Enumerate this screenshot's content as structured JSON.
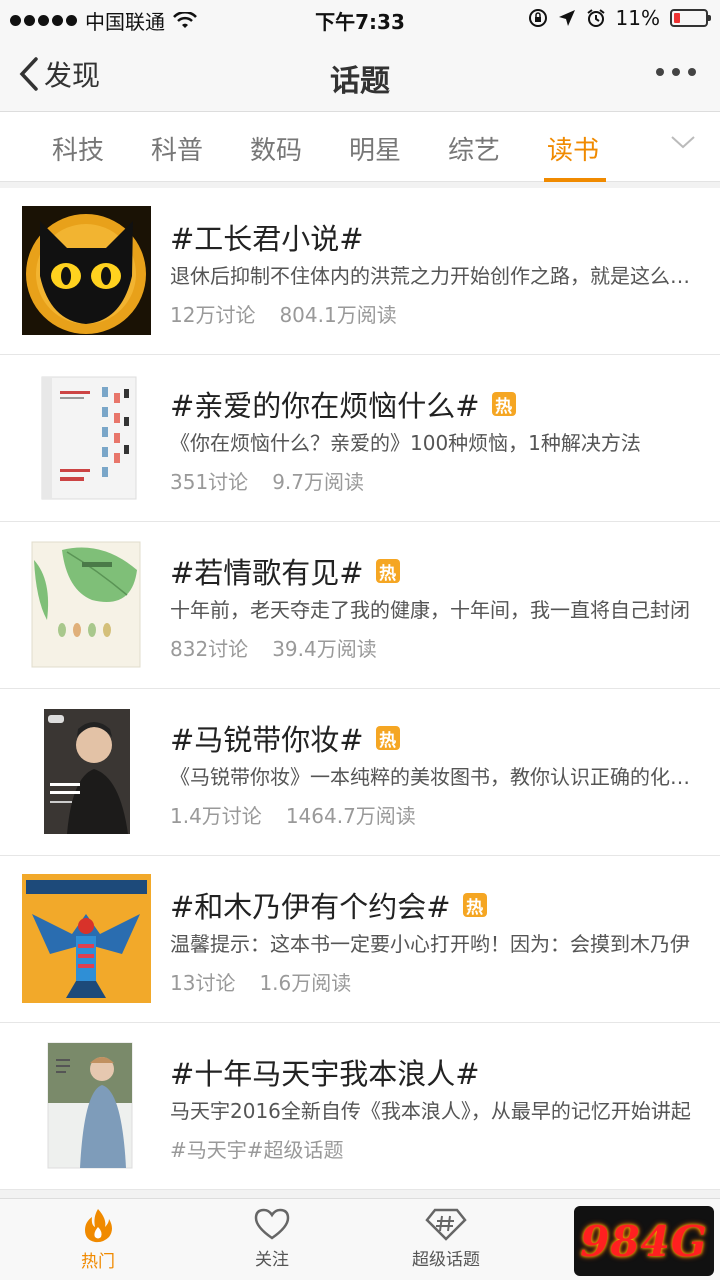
{
  "status_bar": {
    "carrier": "中国联通",
    "time": "下午7:33",
    "battery_percent": "11%",
    "battery_level": 0.11
  },
  "nav": {
    "back_label": "发现",
    "title": "话题"
  },
  "tabs": [
    {
      "label": "科技",
      "active": false
    },
    {
      "label": "科普",
      "active": false
    },
    {
      "label": "数码",
      "active": false
    },
    {
      "label": "明星",
      "active": false
    },
    {
      "label": "综艺",
      "active": false
    },
    {
      "label": "读书",
      "active": true
    }
  ],
  "hot_badge": "热",
  "topics": [
    {
      "title": "#工长君小说#",
      "hot": false,
      "desc": "退休后抑制不住体内的洪荒之力开始创作之路，就是这么任性的工长君",
      "meta": [
        "12万讨论",
        "804.1万阅读"
      ],
      "thumb": "cat-eyes-icon"
    },
    {
      "title": "#亲爱的你在烦恼什么#",
      "hot": true,
      "desc": "《你在烦恼什么？亲爱的》100种烦恼，1种解决方法",
      "meta": [
        "351讨论",
        "9.7万阅读"
      ],
      "thumb": "book-cover-figures"
    },
    {
      "title": "#若情歌有见#",
      "hot": true,
      "desc": "十年前，老天夺走了我的健康，十年间，我一直将自己封闭",
      "meta": [
        "832讨论",
        "39.4万阅读"
      ],
      "thumb": "book-cover-leaves"
    },
    {
      "title": "#马锐带你妆#",
      "hot": true,
      "desc": "《马锐带你妆》一本纯粹的美妆图书，教你认识正确的化妆方法",
      "meta": [
        "1.4万讨论",
        "1464.7万阅读"
      ],
      "thumb": "book-cover-portrait"
    },
    {
      "title": "#和木乃伊有个约会#",
      "hot": true,
      "desc": "温馨提示：这本书一定要小心打开哟！因为：会摸到木乃伊",
      "meta": [
        "13讨论",
        "1.6万阅读"
      ],
      "thumb": "book-cover-mummy"
    },
    {
      "title": "#十年马天宇我本浪人#",
      "hot": false,
      "desc": "马天宇2016全新自传《我本浪人》，从最早的记忆开始讲起",
      "meta": [
        "#马天宇#超级话题"
      ],
      "thumb": "book-cover-person"
    }
  ],
  "tabbar": [
    {
      "label": "热门",
      "icon": "flame-icon",
      "active": true
    },
    {
      "label": "关注",
      "icon": "heart-icon",
      "active": false
    },
    {
      "label": "超级话题",
      "icon": "diamond-hash-icon",
      "active": false
    }
  ],
  "watermark": "984G",
  "colors": {
    "accent": "#f08a00",
    "hot_badge": "#f5a623"
  }
}
